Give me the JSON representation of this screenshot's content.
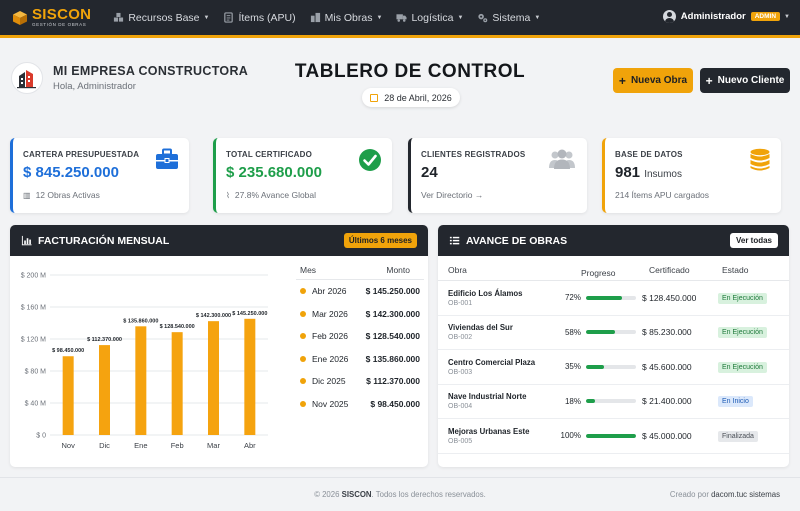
{
  "nav": {
    "brand": "SISCON",
    "brand_sub": "GESTIÓN DE OBRAS",
    "menu": [
      {
        "label": "Recursos Base",
        "icon": "blocks-icon"
      },
      {
        "label": "Ítems (APU)",
        "icon": "list-icon"
      },
      {
        "label": "Mis Obras",
        "icon": "buildings-icon"
      },
      {
        "label": "Logística",
        "icon": "truck-icon"
      },
      {
        "label": "Sistema",
        "icon": "gears-icon"
      }
    ],
    "user": "Administrador",
    "role_badge": "ADMIN"
  },
  "header": {
    "company": "MI EMPRESA CONSTRUCTORA",
    "greeting": "Hola, Administrador",
    "title": "TABLERO DE CONTROL",
    "date": "28 de Abril, 2026",
    "btn_new_obra": "Nueva Obra",
    "btn_new_cliente": "Nuevo Cliente"
  },
  "cards": [
    {
      "label": "CARTERA PRESUPUESTADA",
      "value": "$ 845.250.000",
      "sub": "12 Obras Activas",
      "color": "#1e6fd9",
      "icon": "briefcase-icon"
    },
    {
      "label": "TOTAL CERTIFICADO",
      "value": "$ 235.680.000",
      "sub": "27.8% Avance Global",
      "color": "#1e9e4a",
      "icon": "check-circle-icon"
    },
    {
      "label": "CLIENTES REGISTRADOS",
      "value": "24",
      "sub": "Ver Directorio →",
      "color": "#23272e",
      "icon": "users-icon"
    },
    {
      "label": "BASE DE DATOS",
      "value": "981",
      "value_unit": "Insumos",
      "sub": "214 Ítems APU cargados",
      "color": "#f0a30a",
      "icon": "database-icon"
    }
  ],
  "billing": {
    "title": "FACTURACIÓN MENSUAL",
    "badge": "Últimos 6 meses",
    "col_month": "Mes",
    "col_amount": "Monto",
    "rows": [
      {
        "month": "Abr 2026",
        "amount": "$ 145.250.000"
      },
      {
        "month": "Mar 2026",
        "amount": "$ 142.300.000"
      },
      {
        "month": "Feb 2026",
        "amount": "$ 128.540.000"
      },
      {
        "month": "Ene 2026",
        "amount": "$ 135.860.000"
      },
      {
        "month": "Dic 2025",
        "amount": "$ 112.370.000"
      },
      {
        "month": "Nov 2025",
        "amount": "$ 98.450.000"
      }
    ]
  },
  "chart_data": {
    "type": "bar",
    "categories": [
      "Nov",
      "Dic",
      "Ene",
      "Feb",
      "Mar",
      "Abr"
    ],
    "values": [
      98450000,
      112370000,
      135860000,
      128540000,
      142300000,
      145250000
    ],
    "data_labels": [
      "$ 98.450.000",
      "$ 112.370.000",
      "$ 135.860.000",
      "$ 128.540.000",
      "$ 142.300.000",
      "$ 145.250.000"
    ],
    "y_ticks": [
      0,
      40000000,
      80000000,
      120000000,
      160000000,
      200000000
    ],
    "y_tick_labels": [
      "$ 0",
      "$ 40 M",
      "$ 80 M",
      "$ 120 M",
      "$ 160 M",
      "$ 200 M"
    ],
    "ylim": [
      0,
      200000000
    ],
    "grid": true,
    "bar_color": "#f5a30f"
  },
  "progress": {
    "title": "AVANCE DE OBRAS",
    "button": "Ver todas",
    "headers": [
      "Obra",
      "Progreso",
      "Certificado",
      "Estado"
    ],
    "rows": [
      {
        "name": "Edificio Los Álamos",
        "code": "OB-001",
        "pct_label": "72%",
        "pct": 72,
        "cert": "$ 128.450.000",
        "status": "En Ejecución",
        "status_bg": "#d8f1de",
        "status_fg": "#1e7a3a"
      },
      {
        "name": "Viviendas del Sur",
        "code": "OB-002",
        "pct_label": "58%",
        "pct": 58,
        "cert": "$ 85.230.000",
        "status": "En Ejecución",
        "status_bg": "#d8f1de",
        "status_fg": "#1e7a3a"
      },
      {
        "name": "Centro Comercial Plaza",
        "code": "OB-003",
        "pct_label": "35%",
        "pct": 35,
        "cert": "$ 45.600.000",
        "status": "En Ejecución",
        "status_bg": "#d8f1de",
        "status_fg": "#1e7a3a"
      },
      {
        "name": "Nave Industrial Norte",
        "code": "OB-004",
        "pct_label": "18%",
        "pct": 18,
        "cert": "$ 21.400.000",
        "status": "En Inicio",
        "status_bg": "#dbe8fb",
        "status_fg": "#1e5bb5"
      },
      {
        "name": "Mejoras Urbanas Este",
        "code": "OB-005",
        "pct_label": "100%",
        "pct": 100,
        "cert": "$ 45.000.000",
        "status": "Finalizada",
        "status_bg": "#e6e8eb",
        "status_fg": "#4a4f56"
      }
    ]
  },
  "footer": {
    "copyright_pre": "© 2026",
    "copyright_brand": "SISCON",
    "copyright_post": ". Todos los derechos reservados.",
    "credit_pre": "Creado por",
    "credit_name": "dacom.tuc sistemas"
  }
}
